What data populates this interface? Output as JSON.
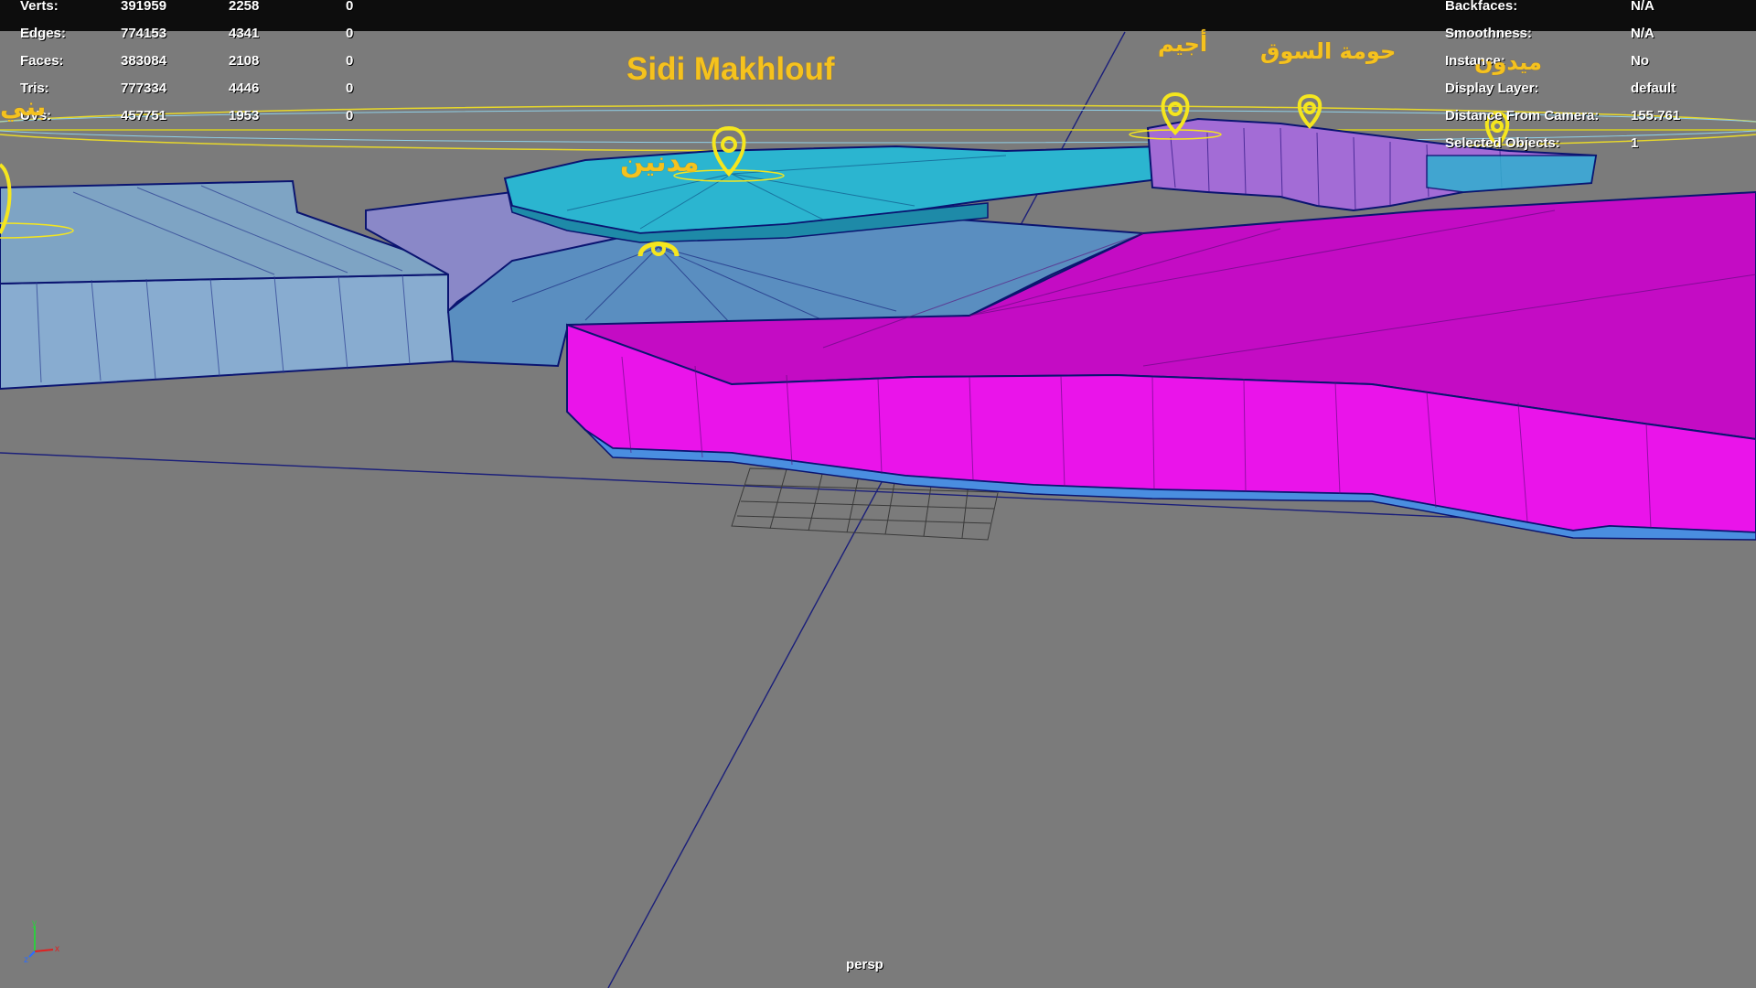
{
  "viewport": {
    "camera_label": "persp",
    "axis": {
      "x": "x",
      "y": "y",
      "z": "z"
    }
  },
  "hud": {
    "stats": [
      {
        "label": "Verts:",
        "total": "391959",
        "selected": "2258",
        "component": "0"
      },
      {
        "label": "Edges:",
        "total": "774153",
        "selected": "4341",
        "component": "0"
      },
      {
        "label": "Faces:",
        "total": "383084",
        "selected": "2108",
        "component": "0"
      },
      {
        "label": "Tris:",
        "total": "777334",
        "selected": "4446",
        "component": "0"
      },
      {
        "label": "UVs:",
        "total": "457751",
        "selected": "1953",
        "component": "0"
      }
    ],
    "properties": [
      {
        "label": "Backfaces:",
        "value": "N/A"
      },
      {
        "label": "Smoothness:",
        "value": "N/A"
      },
      {
        "label": "Instance:",
        "value": "No"
      },
      {
        "label": "Display Layer:",
        "value": "default"
      },
      {
        "label": "Distance From Camera:",
        "value": "155.761"
      },
      {
        "label": "Selected Objects:",
        "value": "1"
      }
    ]
  },
  "labels": {
    "sidi_makhlouf": "Sidi Makhlouf",
    "medenine": "مدنين",
    "ajim": "أجيم",
    "houmt_souk": "حومة السوق",
    "midoun": "ميدون",
    "left_partial": "بني"
  },
  "colors": {
    "background": "#7b7b7b",
    "magenta_region": "#e010e0",
    "cyan_region": "#21a9c8",
    "blue_region": "#6fa0c8",
    "purple_region": "#a070d0",
    "label_yellow": "#f5c21e",
    "pin_yellow": "#f5e61e"
  }
}
